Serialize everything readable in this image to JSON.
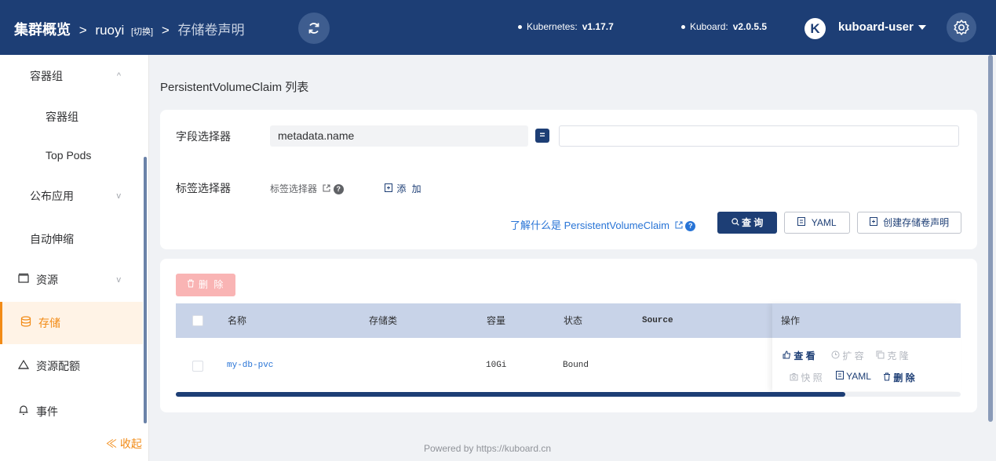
{
  "header": {
    "cluster": "集群概览",
    "sep1": ">",
    "namespace": "ruoyi",
    "switch_label": "[切换]",
    "sep2": ">",
    "page": "存储卷声明",
    "k8s_label": "Kubernetes:",
    "k8s_version": "v1.17.7",
    "kuboard_label": "Kuboard:",
    "kuboard_version": "v2.0.5.5",
    "user_badge": "K",
    "user": "kuboard-user"
  },
  "sidebar": {
    "items": [
      {
        "label": "容器组",
        "chevron": "^"
      },
      {
        "label": "容器组"
      },
      {
        "label": "Top Pods"
      },
      {
        "label": "公布应用",
        "chevron": "v"
      },
      {
        "label": "自动伸缩"
      },
      {
        "label": "资源",
        "chevron": "v",
        "icon": "monitor-icon"
      },
      {
        "label": "存储",
        "icon": "database-icon"
      },
      {
        "label": "资源配额",
        "icon": "quota-icon"
      },
      {
        "label": "事件",
        "icon": "bell-icon"
      }
    ],
    "collapse": "≪ 收起"
  },
  "main": {
    "title": "PersistentVolumeClaim 列表",
    "filter": {
      "field_label": "字段选择器",
      "field_value": "metadata.name",
      "eq": "=",
      "value_placeholder": "",
      "label_label": "标签选择器",
      "label_selector": "标签选择器",
      "add": "添 加",
      "learn": "了解什么是 PersistentVolumeClaim",
      "query": "查 询",
      "yaml": "YAML",
      "create": "创建存储卷声明"
    },
    "list": {
      "delete": "删 除",
      "columns": [
        "名称",
        "存储类",
        "容量",
        "状态",
        "Source",
        "操作"
      ],
      "rows": [
        {
          "name": "my-db-pvc",
          "storage_class": "",
          "capacity": "10Gi",
          "status": "Bound",
          "source": ""
        }
      ],
      "actions": {
        "view": "查 看",
        "expand": "扩 容",
        "clone": "克 隆",
        "snapshot": "快 照",
        "yaml": "YAML",
        "delete": "删 除"
      }
    }
  },
  "footer": "Powered by https://kuboard.cn",
  "colors": {
    "header_bg": "#1d3e75",
    "accent": "#f28b16",
    "link": "#2874d6",
    "danger_light": "#f9b4b4"
  }
}
